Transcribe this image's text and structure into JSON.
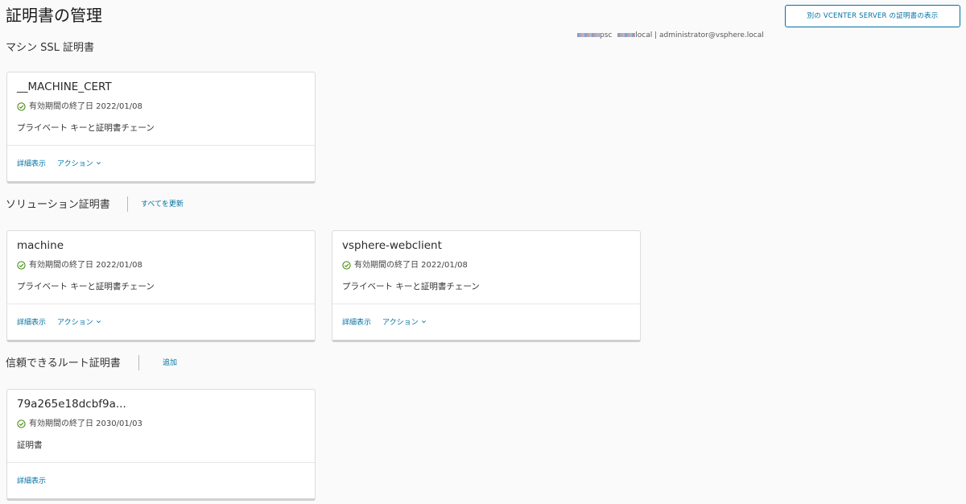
{
  "page": {
    "title": "証明書の管理",
    "other_vcenter_button": "別の VCENTER SERVER の証明書の表示"
  },
  "server_info": {
    "psc_suffix": "psc",
    "host_suffix": "local",
    "separator": "|",
    "user": "administrator@vsphere.local"
  },
  "sections": {
    "machine_ssl": {
      "title": "マシン SSL 証明書",
      "cards": [
        {
          "name": "__MACHINE_CERT",
          "status_icon": "check-circle-icon",
          "status": "有効期間の終了日 2022/01/08",
          "description": "プライベート キーと証明書チェーン",
          "details_link": "詳細表示",
          "actions_link": "アクション"
        }
      ]
    },
    "solution": {
      "title": "ソリューション証明書",
      "action": "すべてを更新",
      "cards": [
        {
          "name": "machine",
          "status_icon": "check-circle-icon",
          "status": "有効期間の終了日 2022/01/08",
          "description": "プライベート キーと証明書チェーン",
          "details_link": "詳細表示",
          "actions_link": "アクション"
        },
        {
          "name": "vsphere-webclient",
          "status_icon": "check-circle-icon",
          "status": "有効期間の終了日 2022/01/08",
          "description": "プライベート キーと証明書チェーン",
          "details_link": "詳細表示",
          "actions_link": "アクション"
        }
      ]
    },
    "trusted_root": {
      "title": "信頼できるルート証明書",
      "action": "追加",
      "cards": [
        {
          "name": "79a265e18dcbf9a...",
          "status_icon": "check-circle-icon",
          "status": "有効期間の終了日 2030/01/03",
          "description": "証明書",
          "details_link": "詳細表示"
        }
      ]
    }
  },
  "colors": {
    "link": "#0072a3",
    "ok_green": "#3c8500",
    "background": "#fafafa",
    "card": "#ffffff"
  }
}
